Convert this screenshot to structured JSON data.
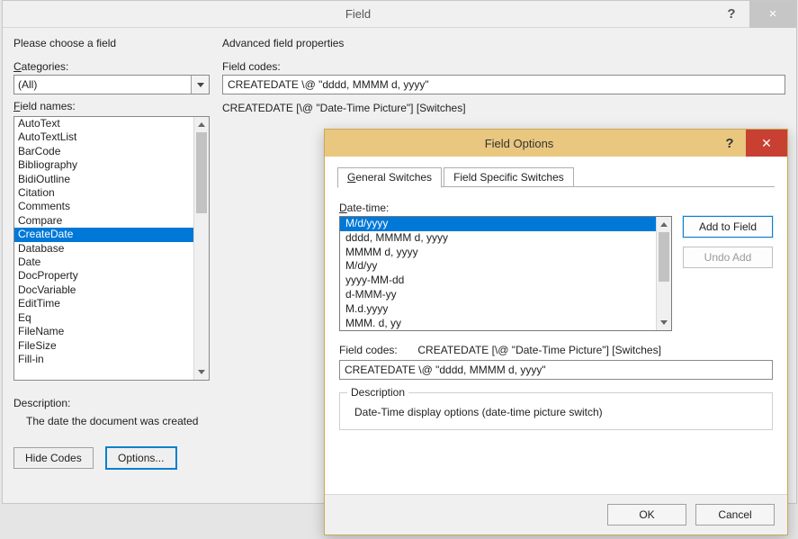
{
  "field_dialog": {
    "title": "Field",
    "help_glyph": "?",
    "close_glyph": "×",
    "choose_heading": "Please choose a field",
    "categories_label_pre": "C",
    "categories_label_post": "ategories:",
    "categories_value": "(All)",
    "fieldnames_label_pre": "F",
    "fieldnames_label_post": "ield names:",
    "fieldnames": [
      "AutoText",
      "AutoTextList",
      "BarCode",
      "Bibliography",
      "BidiOutline",
      "Citation",
      "Comments",
      "Compare",
      "CreateDate",
      "Database",
      "Date",
      "DocProperty",
      "DocVariable",
      "EditTime",
      "Eq",
      "FileName",
      "FileSize",
      "Fill-in"
    ],
    "fieldnames_selected_index": 8,
    "description_label": "Description:",
    "description_text": "The date the document was created",
    "hide_codes_btn_pre": "H",
    "hide_codes_btn_post": "ide Codes",
    "options_btn_pre": "O",
    "options_btn_post": "ptions...",
    "advanced_heading": "Advanced field properties",
    "fieldcodes_label": "Field codes:",
    "fieldcodes_value": "CREATEDATE  \\@ \"dddd, MMMM d, yyyy\"",
    "syntax_line": "CREATEDATE [\\@ \"Date-Time Picture\"] [Switches]"
  },
  "options_dialog": {
    "title": "Field Options",
    "help_glyph": "?",
    "close_glyph": "✕",
    "tab_general_pre": "G",
    "tab_general_post": "eneral Switches",
    "tab_specific": "Field Specific Switches",
    "datetime_label_pre": "D",
    "datetime_label_post": "ate-time:",
    "datetime_options": [
      "M/d/yyyy",
      "dddd, MMMM d, yyyy",
      "MMMM d, yyyy",
      "M/d/yy",
      "yyyy-MM-dd",
      "d-MMM-yy",
      "M.d.yyyy",
      "MMM. d, yy"
    ],
    "datetime_selected_index": 0,
    "add_btn_pre": "A",
    "add_btn_post": "dd to Field",
    "undo_btn_pre": "U",
    "undo_btn_post": "ndo Add",
    "fieldcodes_label_pre": "F",
    "fieldcodes_label_post": "ield codes:",
    "fieldcodes_syntax": "CREATEDATE [\\@ \"Date-Time Picture\"] [Switches]",
    "fieldcodes_value": "CREATEDATE  \\@ \"dddd, MMMM d, yyyy\"",
    "description_legend": "Description",
    "description_text": "Date-Time display options (date-time picture switch)",
    "ok_btn": "OK",
    "cancel_btn": "Cancel"
  }
}
